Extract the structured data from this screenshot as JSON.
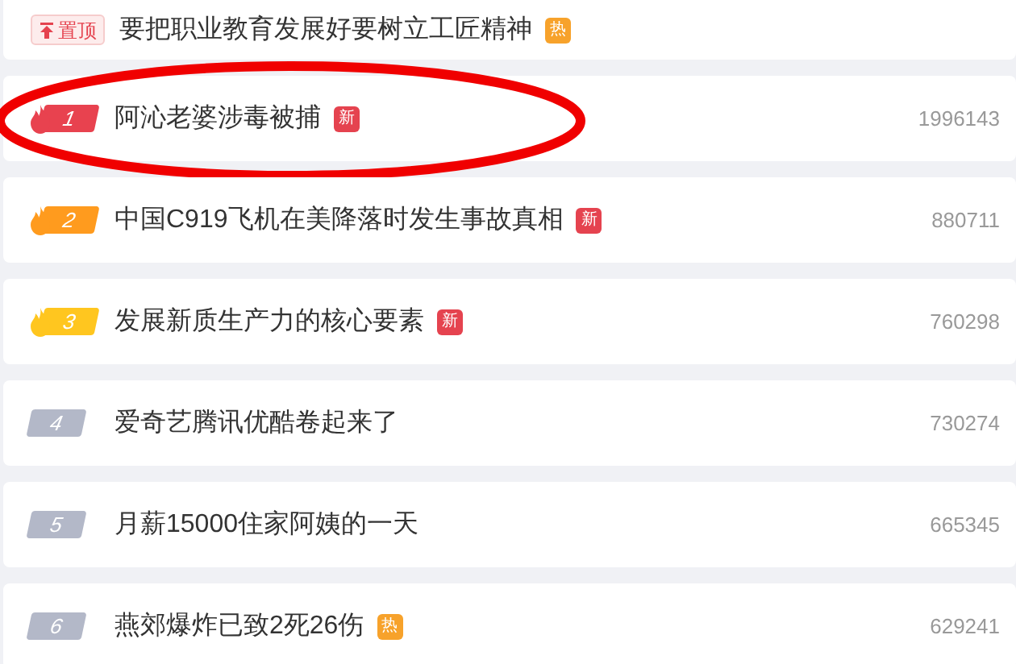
{
  "items": [
    {
      "kind": "pinned",
      "badge": "置顶",
      "title": "要把职业教育发展好要树立工匠精神",
      "tag": {
        "text": "热",
        "color": "#f7a22b"
      },
      "circled": false
    },
    {
      "kind": "ranked",
      "rank": "1",
      "color": "#e8424f",
      "flame": true,
      "title": "阿沁老婆涉毒被捕",
      "tag": {
        "text": "新",
        "color": "#e5434f"
      },
      "count": "1996143",
      "circled": true
    },
    {
      "kind": "ranked",
      "rank": "2",
      "color": "#ff9b1e",
      "flame": true,
      "title": "中国C919飞机在美降落时发生事故真相",
      "tag": {
        "text": "新",
        "color": "#e5434f"
      },
      "count": "880711",
      "circled": false
    },
    {
      "kind": "ranked",
      "rank": "3",
      "color": "#ffc61f",
      "flame": true,
      "title": "发展新质生产力的核心要素",
      "tag": {
        "text": "新",
        "color": "#e5434f"
      },
      "count": "760298",
      "circled": false
    },
    {
      "kind": "ranked",
      "rank": "4",
      "color": "#b3b8c8",
      "flame": false,
      "title": "爱奇艺腾讯优酷卷起来了",
      "count": "730274",
      "circled": false
    },
    {
      "kind": "ranked",
      "rank": "5",
      "color": "#b3b8c8",
      "flame": false,
      "title": "月薪15000住家阿姨的一天",
      "count": "665345",
      "circled": false
    },
    {
      "kind": "ranked",
      "rank": "6",
      "color": "#b3b8c8",
      "flame": false,
      "title": "燕郊爆炸已致2死26伤",
      "tag": {
        "text": "热",
        "color": "#f7a22b"
      },
      "count": "629241",
      "circled": false
    }
  ]
}
